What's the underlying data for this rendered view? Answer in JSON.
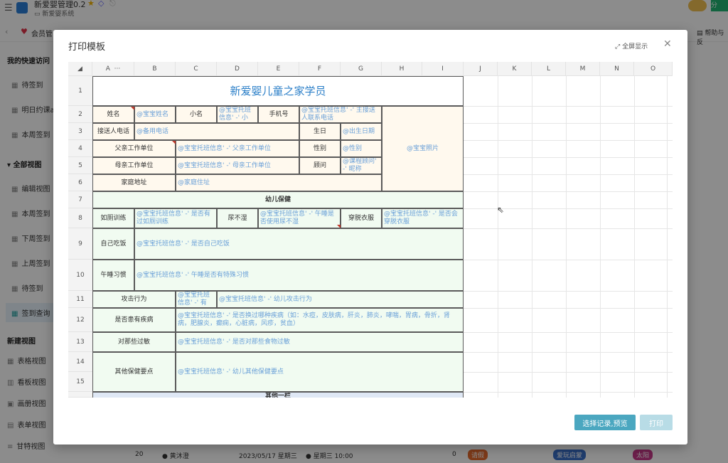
{
  "app": {
    "title": "新爱婴管理0.2",
    "subtitle": "新爱婴系统",
    "tab_label": "会员管",
    "help": "帮助与反",
    "green_btn": "分"
  },
  "sidebar": {
    "quick_title": "我的快速访问",
    "quick_items": [
      "待签到",
      "明日约课a",
      "本周签到"
    ],
    "all_title": "全部视图",
    "all_items": [
      "编辑视图",
      "本周签到",
      "下周签到",
      "上周签到",
      "待签到",
      "签到查询"
    ],
    "new_title": "新建视图",
    "new_items": [
      "表格视图",
      "看板视图",
      "画册视图",
      "表单视图",
      "甘特视图"
    ]
  },
  "bg_row": {
    "num": "20",
    "name": "黄沐澄",
    "date": "2023/05/17 星期三",
    "time": "星期三 10:00",
    "count": "0",
    "tag1": "请假",
    "tag2": "爱玩启蒙",
    "tag3": "太阳"
  },
  "modal": {
    "title": "打印模板",
    "fullscreen_label": "全屏显示",
    "preview_button": "选择记录,预览",
    "print_button": "打印"
  },
  "sheet": {
    "columns": [
      "A",
      "B",
      "C",
      "D",
      "E",
      "F",
      "G",
      "H",
      "I",
      "J",
      "K",
      "L",
      "M",
      "N",
      "O"
    ],
    "col_more": "···",
    "rows": [
      "1",
      "2",
      "3",
      "4",
      "5",
      "6",
      "7",
      "8",
      "9",
      "10",
      "11",
      "12",
      "13",
      "14",
      "15"
    ],
    "title": "新爱婴儿童之家学员",
    "cells": {
      "name_label": "姓名",
      "name_val": "@宝宝姓名",
      "nick_label": "小名",
      "nick_val": "@宝宝托班信息' -' 小",
      "phone_label": "手机号",
      "phone_val": "@宝宝托班信息' -' 主接送人联系电话",
      "photo_val": "@宝宝照片",
      "pickup_label": "接送人电话",
      "pickup_val": "@备用电话",
      "birth_label": "生日",
      "birth_val": "@出生日期",
      "father_label": "父亲工作单位",
      "father_val": "@宝宝托班信息' -' 父亲工作单位",
      "gender_label": "性别",
      "gender_val": "@性别",
      "mother_label": "母亲工作单位",
      "mother_val": "@宝宝托班信息' -' 母亲工作单位",
      "advisor_label": "顾问",
      "advisor_val": "@课程顾问' -' 昵称",
      "address_label": "家庭地址",
      "address_val": "@家庭住址",
      "health_title": "幼儿保健",
      "toilet_label": "如厕训练",
      "toilet_val": "@宝宝托班信息' -' 是否有过如厕训练",
      "diaper_label": "尿不湿",
      "diaper_val": "@宝宝托班信息' -' 午睡是否使用尿不湿",
      "dress_label": "穿脱衣服",
      "dress_val": "@宝宝托班信息' -' 是否会穿脱衣服",
      "eat_label": "自己吃饭",
      "eat_val": "@宝宝托班信息' -' 是否自己吃饭",
      "nap_label": "午睡习惯",
      "nap_val": "@宝宝托班信息' -' 午睡是否有特殊习惯",
      "attack_label": "攻击行为",
      "attack_val": "@宝宝托班信息' -' 有",
      "attack_val2": "@宝宝托班信息' -' 幼儿攻击行为",
      "disease_label": "是否患有疾病",
      "disease_val": "@宝宝托班信息' -' 是否换过哪种疾病（如：水痘，皮肤病，肝炎，肺炎，哮喘，胃病，骨折，肾病，肥腺炎，癫痫，心脏病，风疹，贫血）",
      "allergy_label": "对那些过敏",
      "allergy_val": "@宝宝托班信息' -' 是否对那些食物过敏",
      "other_label": "其他保健要点",
      "other_val": "@宝宝托班信息' -' 幼儿其他保健要点",
      "cut_off": "其他一栏"
    }
  }
}
